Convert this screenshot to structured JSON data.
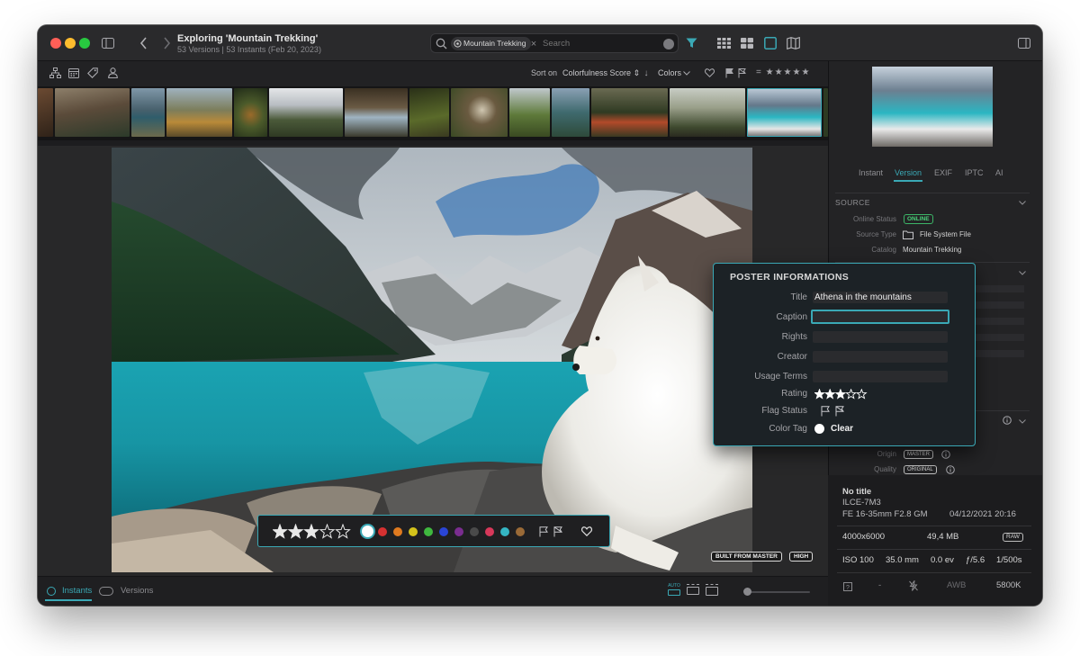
{
  "window": {
    "title": "Exploring 'Mountain Trekking'",
    "subtitle": "53 Versions | 53 Instants (Feb 20, 2023)"
  },
  "search": {
    "chip_label": "Mountain Trekking",
    "placeholder": "Search"
  },
  "toolbar2": {
    "sort_on_label": "Sort on",
    "sort_value": "Colorfulness Score ⇕",
    "colors_label": "Colors",
    "rating_filter": "= ★★★★★"
  },
  "photo_badges": {
    "built_from_master": "BUILT FROM MASTER",
    "quality": "HIGH"
  },
  "rating_bar": {
    "rating": 3,
    "max_rating": 5,
    "color_dots": [
      "#ffffff",
      "#d63131",
      "#e07a1f",
      "#d4c21b",
      "#3fb83f",
      "#2a45d6",
      "#7a2d8f",
      "#4a4a4a",
      "#d8385a",
      "#35b6c4",
      "#9a6a37"
    ]
  },
  "bottom": {
    "instants_label": "Instants",
    "versions_label": "Versions",
    "grid_auto_label": "AUTO"
  },
  "panel": {
    "tabs": [
      "Instant",
      "Version",
      "EXIF",
      "IPTC",
      "AI"
    ],
    "active_tab": "Version",
    "source_header": "SOURCE",
    "online_status_label": "Online Status",
    "online_status_value": "ONLINE",
    "source_type_label": "Source Type",
    "source_type_value": "File System File",
    "catalog_label": "Catalog",
    "catalog_value": "Mountain Trekking",
    "origin_label": "Origin",
    "origin_value": "MASTER",
    "quality_label": "Quality",
    "quality_value": "ORIGINAL"
  },
  "exif": {
    "title": "No title",
    "camera": "ILCE-7M3",
    "lens": "FE 16-35mm F2.8 GM",
    "date": "04/12/2021 20:16",
    "dimensions": "4000x6000",
    "file_size": "49,4 MB",
    "format_badge": "RAW",
    "iso": "ISO 100",
    "focal_length": "35.0 mm",
    "exposure_comp": "0.0 ev",
    "aperture": "ƒ/5.6",
    "shutter": "1/500s",
    "metering": "-",
    "white_balance": "AWB",
    "temperature": "5800K"
  },
  "popup": {
    "header": "POSTER INFORMATIONS",
    "title_label": "Title",
    "title_value": "Athena in the mountains",
    "caption_label": "Caption",
    "caption_value": "",
    "rights_label": "Rights",
    "creator_label": "Creator",
    "usage_terms_label": "Usage Terms",
    "rating_label": "Rating",
    "rating": 3,
    "max_rating": 5,
    "flag_status_label": "Flag Status",
    "color_tag_label": "Color Tag",
    "color_tag_value": "Clear"
  }
}
